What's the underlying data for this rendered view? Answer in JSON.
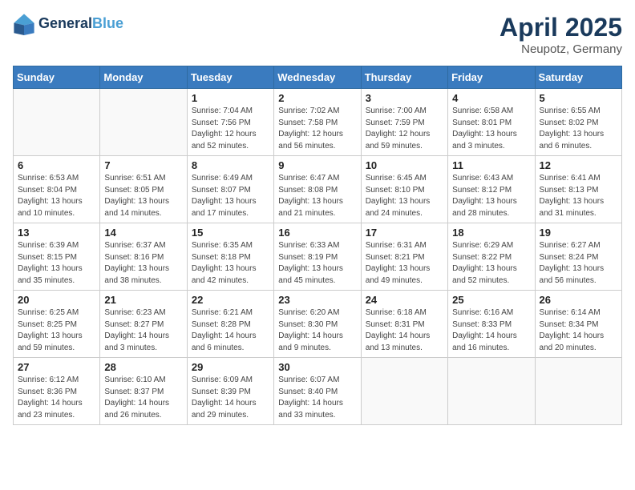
{
  "header": {
    "logo_line1": "General",
    "logo_line2": "Blue",
    "title": "April 2025",
    "location": "Neupotz, Germany"
  },
  "weekdays": [
    "Sunday",
    "Monday",
    "Tuesday",
    "Wednesday",
    "Thursday",
    "Friday",
    "Saturday"
  ],
  "weeks": [
    [
      {
        "day": "",
        "info": ""
      },
      {
        "day": "",
        "info": ""
      },
      {
        "day": "1",
        "info": "Sunrise: 7:04 AM\nSunset: 7:56 PM\nDaylight: 12 hours and 52 minutes."
      },
      {
        "day": "2",
        "info": "Sunrise: 7:02 AM\nSunset: 7:58 PM\nDaylight: 12 hours and 56 minutes."
      },
      {
        "day": "3",
        "info": "Sunrise: 7:00 AM\nSunset: 7:59 PM\nDaylight: 12 hours and 59 minutes."
      },
      {
        "day": "4",
        "info": "Sunrise: 6:58 AM\nSunset: 8:01 PM\nDaylight: 13 hours and 3 minutes."
      },
      {
        "day": "5",
        "info": "Sunrise: 6:55 AM\nSunset: 8:02 PM\nDaylight: 13 hours and 6 minutes."
      }
    ],
    [
      {
        "day": "6",
        "info": "Sunrise: 6:53 AM\nSunset: 8:04 PM\nDaylight: 13 hours and 10 minutes."
      },
      {
        "day": "7",
        "info": "Sunrise: 6:51 AM\nSunset: 8:05 PM\nDaylight: 13 hours and 14 minutes."
      },
      {
        "day": "8",
        "info": "Sunrise: 6:49 AM\nSunset: 8:07 PM\nDaylight: 13 hours and 17 minutes."
      },
      {
        "day": "9",
        "info": "Sunrise: 6:47 AM\nSunset: 8:08 PM\nDaylight: 13 hours and 21 minutes."
      },
      {
        "day": "10",
        "info": "Sunrise: 6:45 AM\nSunset: 8:10 PM\nDaylight: 13 hours and 24 minutes."
      },
      {
        "day": "11",
        "info": "Sunrise: 6:43 AM\nSunset: 8:12 PM\nDaylight: 13 hours and 28 minutes."
      },
      {
        "day": "12",
        "info": "Sunrise: 6:41 AM\nSunset: 8:13 PM\nDaylight: 13 hours and 31 minutes."
      }
    ],
    [
      {
        "day": "13",
        "info": "Sunrise: 6:39 AM\nSunset: 8:15 PM\nDaylight: 13 hours and 35 minutes."
      },
      {
        "day": "14",
        "info": "Sunrise: 6:37 AM\nSunset: 8:16 PM\nDaylight: 13 hours and 38 minutes."
      },
      {
        "day": "15",
        "info": "Sunrise: 6:35 AM\nSunset: 8:18 PM\nDaylight: 13 hours and 42 minutes."
      },
      {
        "day": "16",
        "info": "Sunrise: 6:33 AM\nSunset: 8:19 PM\nDaylight: 13 hours and 45 minutes."
      },
      {
        "day": "17",
        "info": "Sunrise: 6:31 AM\nSunset: 8:21 PM\nDaylight: 13 hours and 49 minutes."
      },
      {
        "day": "18",
        "info": "Sunrise: 6:29 AM\nSunset: 8:22 PM\nDaylight: 13 hours and 52 minutes."
      },
      {
        "day": "19",
        "info": "Sunrise: 6:27 AM\nSunset: 8:24 PM\nDaylight: 13 hours and 56 minutes."
      }
    ],
    [
      {
        "day": "20",
        "info": "Sunrise: 6:25 AM\nSunset: 8:25 PM\nDaylight: 13 hours and 59 minutes."
      },
      {
        "day": "21",
        "info": "Sunrise: 6:23 AM\nSunset: 8:27 PM\nDaylight: 14 hours and 3 minutes."
      },
      {
        "day": "22",
        "info": "Sunrise: 6:21 AM\nSunset: 8:28 PM\nDaylight: 14 hours and 6 minutes."
      },
      {
        "day": "23",
        "info": "Sunrise: 6:20 AM\nSunset: 8:30 PM\nDaylight: 14 hours and 9 minutes."
      },
      {
        "day": "24",
        "info": "Sunrise: 6:18 AM\nSunset: 8:31 PM\nDaylight: 14 hours and 13 minutes."
      },
      {
        "day": "25",
        "info": "Sunrise: 6:16 AM\nSunset: 8:33 PM\nDaylight: 14 hours and 16 minutes."
      },
      {
        "day": "26",
        "info": "Sunrise: 6:14 AM\nSunset: 8:34 PM\nDaylight: 14 hours and 20 minutes."
      }
    ],
    [
      {
        "day": "27",
        "info": "Sunrise: 6:12 AM\nSunset: 8:36 PM\nDaylight: 14 hours and 23 minutes."
      },
      {
        "day": "28",
        "info": "Sunrise: 6:10 AM\nSunset: 8:37 PM\nDaylight: 14 hours and 26 minutes."
      },
      {
        "day": "29",
        "info": "Sunrise: 6:09 AM\nSunset: 8:39 PM\nDaylight: 14 hours and 29 minutes."
      },
      {
        "day": "30",
        "info": "Sunrise: 6:07 AM\nSunset: 8:40 PM\nDaylight: 14 hours and 33 minutes."
      },
      {
        "day": "",
        "info": ""
      },
      {
        "day": "",
        "info": ""
      },
      {
        "day": "",
        "info": ""
      }
    ]
  ]
}
